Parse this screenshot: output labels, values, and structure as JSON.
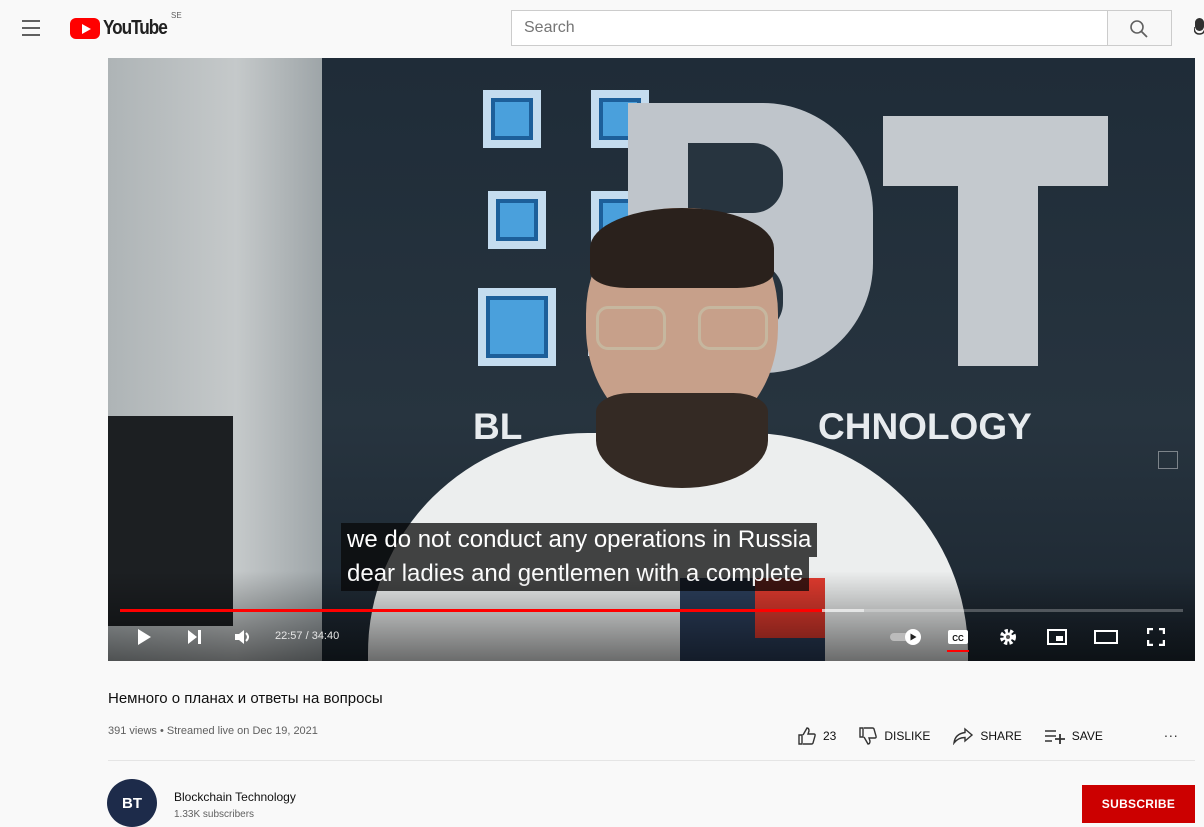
{
  "header": {
    "logo_text": "YouTube",
    "region": "SE",
    "search_placeholder": "Search"
  },
  "player": {
    "banner_words": [
      "BL",
      "CHNOLOGY"
    ],
    "banner_letters": "BT",
    "caption_lines": [
      "we do not conduct any operations in Russia",
      "dear ladies and gentlemen with a complete"
    ],
    "time_current": "22:57",
    "time_total": "34:40",
    "time_display": "22:57 / 34:40",
    "progress_played_fraction": 0.66,
    "progress_buffered_fraction": 0.7,
    "autoplay_on": true,
    "captions_on": true,
    "controls": [
      "play",
      "next",
      "volume",
      "autoplay",
      "subtitles",
      "settings",
      "miniplayer",
      "theater",
      "fullscreen"
    ]
  },
  "video": {
    "title": "Немного о планах и ответы на вопросы",
    "meta": "391 views • Streamed live on Dec 19, 2021",
    "likes": "23",
    "dislike_label": "DISLIKE",
    "share_label": "SHARE",
    "save_label": "SAVE",
    "more": "..."
  },
  "channel": {
    "avatar_text": "BT",
    "name": "Blockchain Technology",
    "subscribers": "1.33K subscribers",
    "subscribe_label": "SUBSCRIBE"
  },
  "colors": {
    "brand_red": "#ff0000",
    "subscribe_red": "#cc0000",
    "background": "#f9f9f9"
  }
}
